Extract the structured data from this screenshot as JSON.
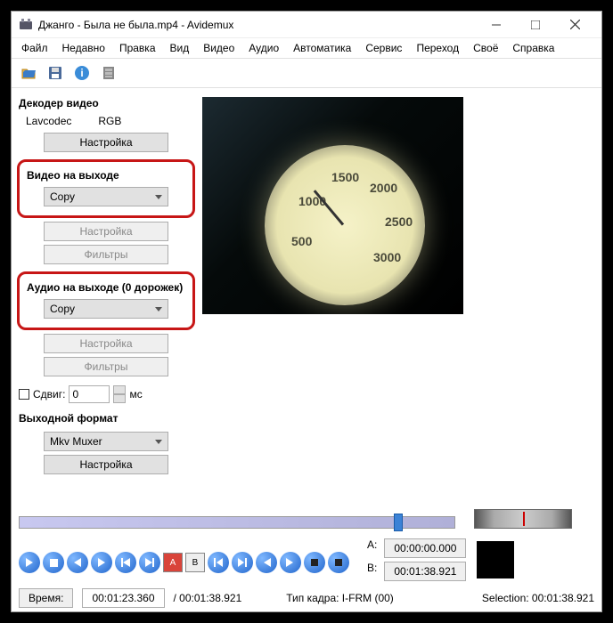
{
  "titlebar": {
    "title": "Джанго - Была не была.mp4 - Avidemux"
  },
  "menu": {
    "file": "Файл",
    "recent": "Недавно",
    "edit": "Правка",
    "view": "Вид",
    "video": "Видео",
    "audio": "Аудио",
    "auto": "Автоматика",
    "tools": "Сервис",
    "go": "Переход",
    "custom": "Своё",
    "help": "Справка"
  },
  "decoder": {
    "label": "Декодер видео",
    "lav": "Lavcodec",
    "rgb": "RGB",
    "setup": "Настройка"
  },
  "vout": {
    "label": "Видео на выходе",
    "value": "Copy",
    "setup": "Настройка",
    "filters": "Фильтры"
  },
  "aout": {
    "label": "Аудио на выходе (0 дорожек)",
    "value": "Copy",
    "setup": "Настройка",
    "filters": "Фильтры"
  },
  "shift": {
    "label": "Сдвиг:",
    "value": "0",
    "unit": "мс"
  },
  "format": {
    "label": "Выходной формат",
    "value": "Mkv Muxer",
    "setup": "Настройка"
  },
  "ab": {
    "a_label": "A:",
    "a_val": "00:00:00.000",
    "b_label": "B:",
    "b_val": "00:01:38.921"
  },
  "status": {
    "time_label": "Время:",
    "time_val": "00:01:23.360",
    "total": " / 00:01:38.921",
    "frametype": "Тип кадра:  I-FRM (00)",
    "selection": "Selection: 00:01:38.921"
  },
  "gauge": {
    "t1": "500",
    "t2": "1000",
    "t3": "1500",
    "t4": "2000",
    "t5": "2500",
    "t6": "3000"
  }
}
